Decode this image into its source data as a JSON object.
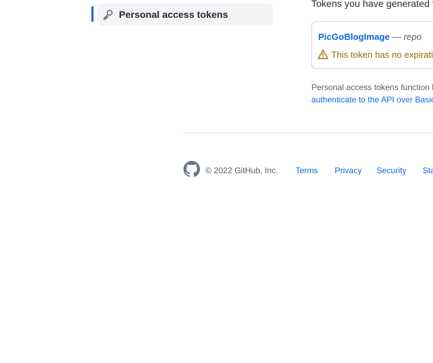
{
  "sidebar": {
    "active_item": {
      "icon": "key-icon",
      "label": "Personal access tokens"
    }
  },
  "main": {
    "intro": "Tokens you have generated that can be used to access the GitHub API.",
    "token": {
      "name": "PicGoBlogImage",
      "separator": "—",
      "scope": "repo",
      "warning_icon": "alert-icon",
      "warning": "This token has no expiration date."
    },
    "footnote": {
      "text": "Personal access tokens function like ordinary OAuth access tokens. They can be used instead of a password for Git over HTTPS, or can be used to",
      "link": "authenticate to the API over Basic Authentication."
    }
  },
  "footer": {
    "logo_icon": "github-mark-icon",
    "copyright": "© 2022 GitHub, Inc.",
    "links": [
      "Terms",
      "Privacy",
      "Security",
      "Status"
    ]
  },
  "colors": {
    "accent": "#0969da",
    "warning": "#9a6700",
    "muted": "#57606a",
    "border": "#d0d7de",
    "sidebar_active_bg": "#f3f4f6"
  }
}
